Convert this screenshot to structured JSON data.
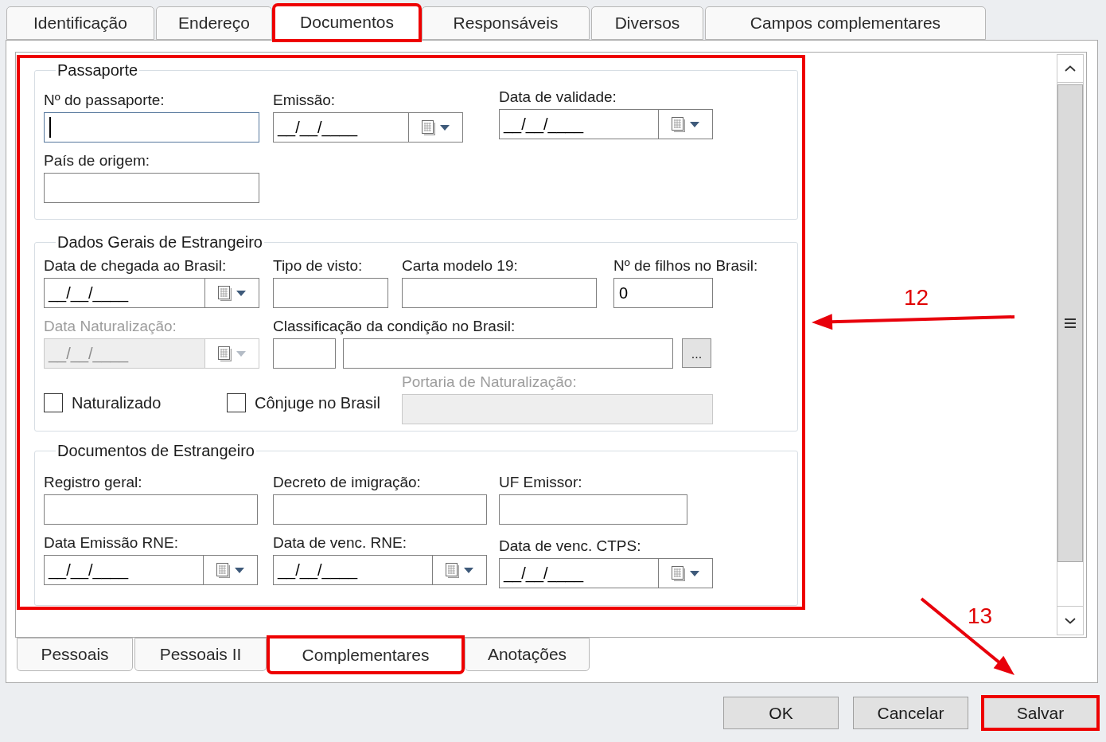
{
  "top_tabs": [
    {
      "label": "Identificação",
      "selected": false,
      "highlighted": false
    },
    {
      "label": "Endereço",
      "selected": false,
      "highlighted": false
    },
    {
      "label": "Documentos",
      "selected": true,
      "highlighted": true
    },
    {
      "label": "Responsáveis",
      "selected": false,
      "highlighted": false
    },
    {
      "label": "Diversos",
      "selected": false,
      "highlighted": false
    },
    {
      "label": "Campos complementares",
      "selected": false,
      "highlighted": false
    }
  ],
  "form": {
    "highlighted": true,
    "groups": [
      {
        "title": "Passaporte",
        "fields": [
          {
            "kind": "text",
            "label": "Nº do passaporte:",
            "disabled": false,
            "focused": true
          },
          {
            "kind": "date",
            "label": "Emissão:",
            "value": "__/__/____",
            "disabled": false,
            "focused": false
          },
          {
            "kind": "date",
            "label": "Data de validade:",
            "value": "__/__/____",
            "disabled": false,
            "focused": false
          },
          {
            "kind": "text",
            "label": "País de origem:",
            "disabled": false,
            "focused": false
          }
        ]
      },
      {
        "title": "Dados Gerais de Estrangeiro",
        "fields": [
          {
            "kind": "date",
            "label": "Data de chegada ao Brasil:",
            "value": "__/__/____",
            "disabled": false,
            "focused": false
          },
          {
            "kind": "text",
            "label": "Tipo de visto:",
            "disabled": false,
            "focused": false
          },
          {
            "kind": "text",
            "label": "Carta modelo 19:",
            "disabled": false,
            "focused": false
          },
          {
            "kind": "text",
            "label": "Nº de filhos no Brasil:",
            "value": "0",
            "disabled": false,
            "focused": false
          },
          {
            "kind": "date",
            "label": "Data Naturalização:",
            "value": "__/__/____",
            "disabled": true,
            "focused": false
          },
          {
            "kind": "lookup",
            "label": "Classificação da condição no Brasil:",
            "button_label": "...",
            "disabled": false,
            "focused": false
          },
          {
            "kind": "checkbox",
            "label": "Naturalizado",
            "checked": false
          },
          {
            "kind": "checkbox",
            "label": "Cônjuge no Brasil",
            "checked": false
          },
          {
            "kind": "text",
            "label": "Portaria de Naturalização:",
            "disabled": true,
            "focused": false
          }
        ]
      },
      {
        "title": "Documentos de Estrangeiro",
        "fields": [
          {
            "kind": "text",
            "label": "Registro geral:",
            "disabled": false,
            "focused": false
          },
          {
            "kind": "text",
            "label": "Decreto de imigração:",
            "disabled": false,
            "focused": false
          },
          {
            "kind": "text",
            "label": "UF Emissor:",
            "disabled": false,
            "focused": false
          },
          {
            "kind": "date",
            "label": "Data Emissão RNE:",
            "value": "__/__/____",
            "disabled": false,
            "focused": false
          },
          {
            "kind": "date",
            "label": "Data de venc. RNE:",
            "value": "__/__/____",
            "disabled": false,
            "focused": false
          },
          {
            "kind": "date",
            "label": "Data de venc. CTPS:",
            "value": "__/__/____",
            "disabled": false,
            "focused": false
          }
        ]
      }
    ]
  },
  "bottom_tabs": [
    {
      "label": "Pessoais",
      "selected": false,
      "highlighted": false
    },
    {
      "label": "Pessoais II",
      "selected": false,
      "highlighted": false
    },
    {
      "label": "Complementares",
      "selected": true,
      "highlighted": true
    },
    {
      "label": "Anotações",
      "selected": false,
      "highlighted": false
    }
  ],
  "buttons": [
    {
      "label": "OK",
      "highlighted": false
    },
    {
      "label": "Cancelar",
      "highlighted": false
    },
    {
      "label": "Salvar",
      "highlighted": true
    }
  ],
  "callouts": [
    {
      "label": "12"
    },
    {
      "label": "13"
    }
  ]
}
